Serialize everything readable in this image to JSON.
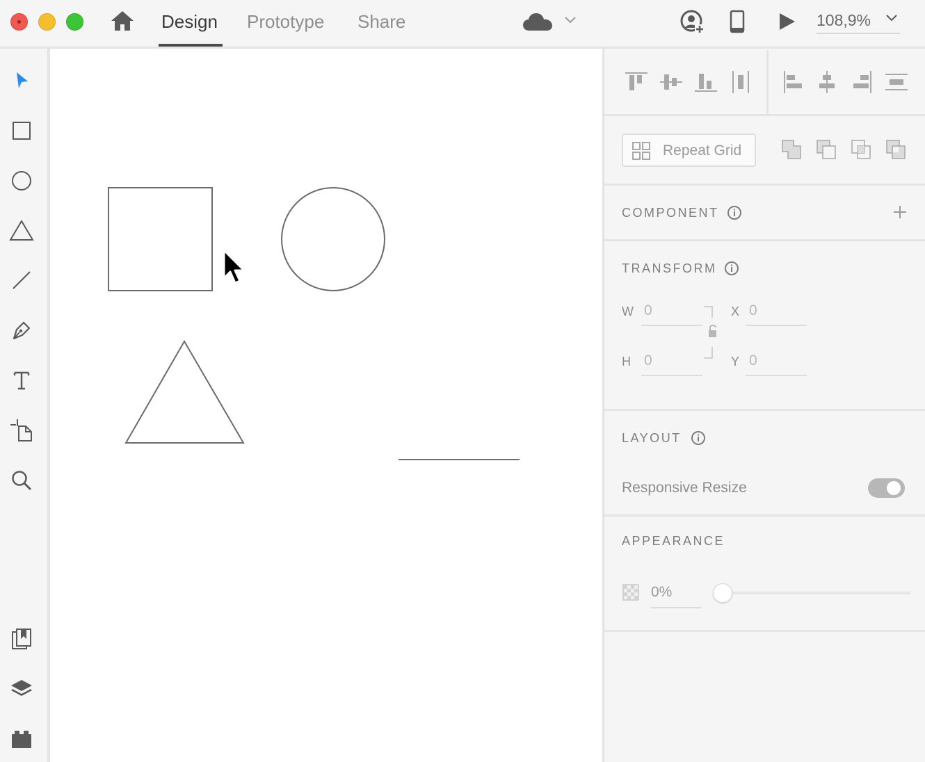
{
  "tabs": [
    {
      "label": "Design",
      "active": true
    },
    {
      "label": "Prototype",
      "active": false
    },
    {
      "label": "Share",
      "active": false
    }
  ],
  "zoom": {
    "value": "108,9%"
  },
  "icons": {
    "home": "home-icon",
    "cloud": "cloud-icon",
    "share_user": "user-add-icon",
    "device": "phone-icon",
    "play": "play-icon"
  },
  "tools": [
    "select",
    "rectangle",
    "ellipse",
    "polygon",
    "line",
    "pen",
    "text",
    "artboard",
    "zoom",
    "assets",
    "layers",
    "plugins"
  ],
  "colors": {
    "accent": "#2d8ceb",
    "shape_stroke": "#6b6b6b"
  },
  "panel": {
    "repeat_grid": {
      "label": "Repeat Grid"
    },
    "component": {
      "title": "COMPONENT"
    },
    "transform": {
      "title": "TRANSFORM",
      "w_label": "W",
      "w_value": "0",
      "h_label": "H",
      "h_value": "0",
      "x_label": "X",
      "x_value": "0",
      "y_label": "Y",
      "y_value": "0"
    },
    "layout": {
      "title": "LAYOUT",
      "responsive_label": "Responsive Resize",
      "responsive_on": true
    },
    "appearance": {
      "title": "APPEARANCE",
      "opacity_value": "0%",
      "opacity_level": 0
    }
  }
}
